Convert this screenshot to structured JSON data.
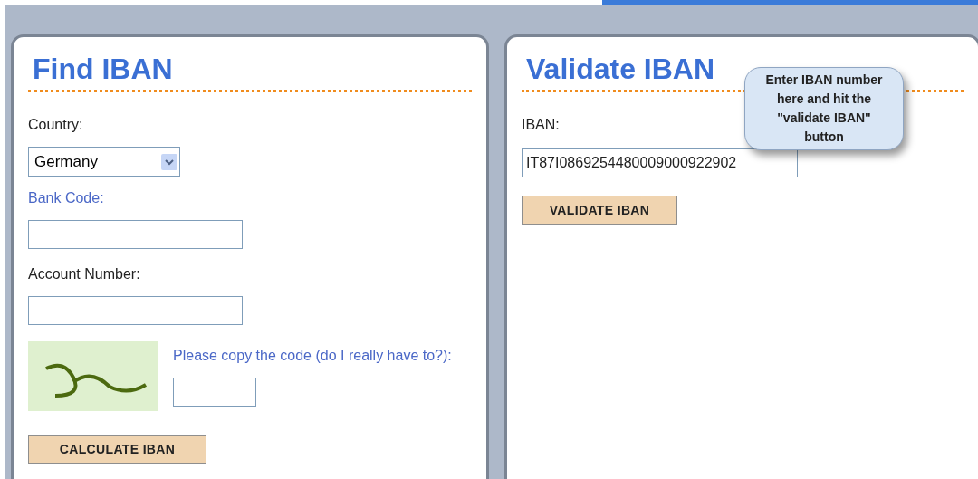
{
  "find_panel": {
    "title": "Find IBAN",
    "country_label": "Country:",
    "country_value": "Germany",
    "bank_code_label": "Bank Code:",
    "account_label": "Account Number:",
    "captcha_prompt": "Please copy the code (do I really have to?):",
    "button": "CALCULATE IBAN"
  },
  "validate_panel": {
    "title": "Validate IBAN",
    "iban_label": "IBAN:",
    "iban_value": "IT87I0869254480009000922902",
    "button": "VALIDATE IBAN",
    "callout": "Enter IBAN number here and hit the \"validate IBAN\" button"
  }
}
